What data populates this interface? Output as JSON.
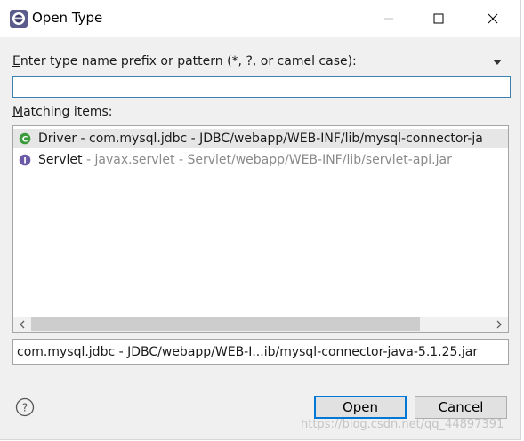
{
  "window": {
    "title": "Open Type"
  },
  "titlebar_buttons": {
    "minimize": "minimize-icon",
    "maximize": "maximize-icon",
    "close": "close-icon"
  },
  "prompt": {
    "mnemonic": "E",
    "rest": "nter type name prefix or pattern (*, ?, or camel case):"
  },
  "search": {
    "value": "",
    "placeholder": ""
  },
  "matching": {
    "mnemonic": "M",
    "rest": "atching items:"
  },
  "items": [
    {
      "icon": "class-icon",
      "name": "Driver",
      "detail": " - com.mysql.jdbc - JDBC/webapp/WEB-INF/lib/mysql-connector-ja",
      "selected": true
    },
    {
      "icon": "interface-icon",
      "name": "Servlet",
      "detail": " - javax.servlet - Servlet/webapp/WEB-INF/lib/servlet-api.jar",
      "selected": false
    }
  ],
  "detail": {
    "text": "com.mysql.jdbc - JDBC/webapp/WEB-I...ib/mysql-connector-java-5.1.25.jar"
  },
  "buttons": {
    "open_mnemonic": "O",
    "open_rest": "pen",
    "cancel": "Cancel"
  },
  "watermark": "https://blog.csdn.net/qq_44897391",
  "colors": {
    "accent": "#0078d7",
    "class_icon": "#3a9b3a",
    "interface_icon": "#6b5aa8"
  }
}
